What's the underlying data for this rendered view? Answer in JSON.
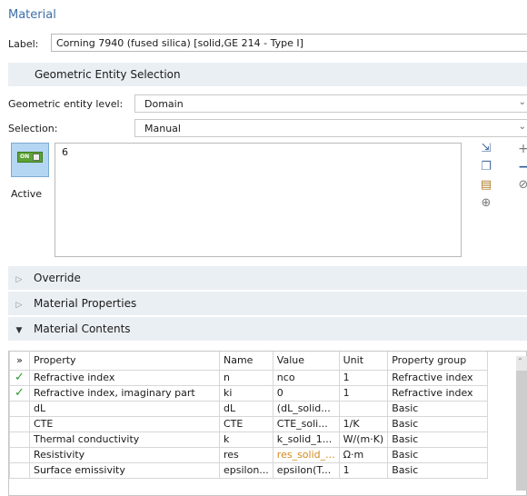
{
  "header": {
    "title": "Material"
  },
  "label": {
    "key": "Label:",
    "value": "Corning 7940 (fused silica) [solid,GE 214 - Type I]"
  },
  "sections": {
    "geometric_entity_selection": "Geometric Entity Selection",
    "override": "Override",
    "material_properties": "Material Properties",
    "material_contents": "Material Contents"
  },
  "geometry": {
    "entity_level_label": "Geometric entity level:",
    "entity_level_value": "Domain",
    "selection_label": "Selection:",
    "selection_value": "Manual",
    "selection_items": "6",
    "toggle_label": "ON",
    "active_label": "Active"
  },
  "table": {
    "headers": {
      "property": "Property",
      "name": "Name",
      "value": "Value",
      "unit": "Unit",
      "group": "Property group"
    },
    "rows": [
      {
        "status": "✓",
        "property": "Refractive index",
        "name": "n",
        "value": "nco",
        "unit": "1",
        "group": "Refractive index"
      },
      {
        "status": "✓",
        "property": "Refractive index, imaginary part",
        "name": "ki",
        "value": "0",
        "unit": "1",
        "group": "Refractive index"
      },
      {
        "status": "",
        "property": "dL",
        "name": "dL",
        "value": "(dL_solid...",
        "unit": "",
        "group": "Basic"
      },
      {
        "status": "",
        "property": "CTE",
        "name": "CTE",
        "value": "CTE_soli...",
        "unit": "1/K",
        "group": "Basic"
      },
      {
        "status": "",
        "property": "Thermal conductivity",
        "name": "k",
        "value": "k_solid_1...",
        "unit": "W/(m·K)",
        "group": "Basic"
      },
      {
        "status": "",
        "property": "Resistivity",
        "name": "res",
        "value": "res_solid_...",
        "unit": "Ω·m",
        "group": "Basic"
      },
      {
        "status": "",
        "property": "Surface emissivity",
        "name": "epsilon...",
        "value": "epsilon(T...",
        "unit": "1",
        "group": "Basic"
      }
    ]
  },
  "colors": {
    "section_bg": "#eaeff4",
    "title": "#3c6fa8",
    "check": "#2d9a2d",
    "highlight_value": "#d08a1c"
  }
}
